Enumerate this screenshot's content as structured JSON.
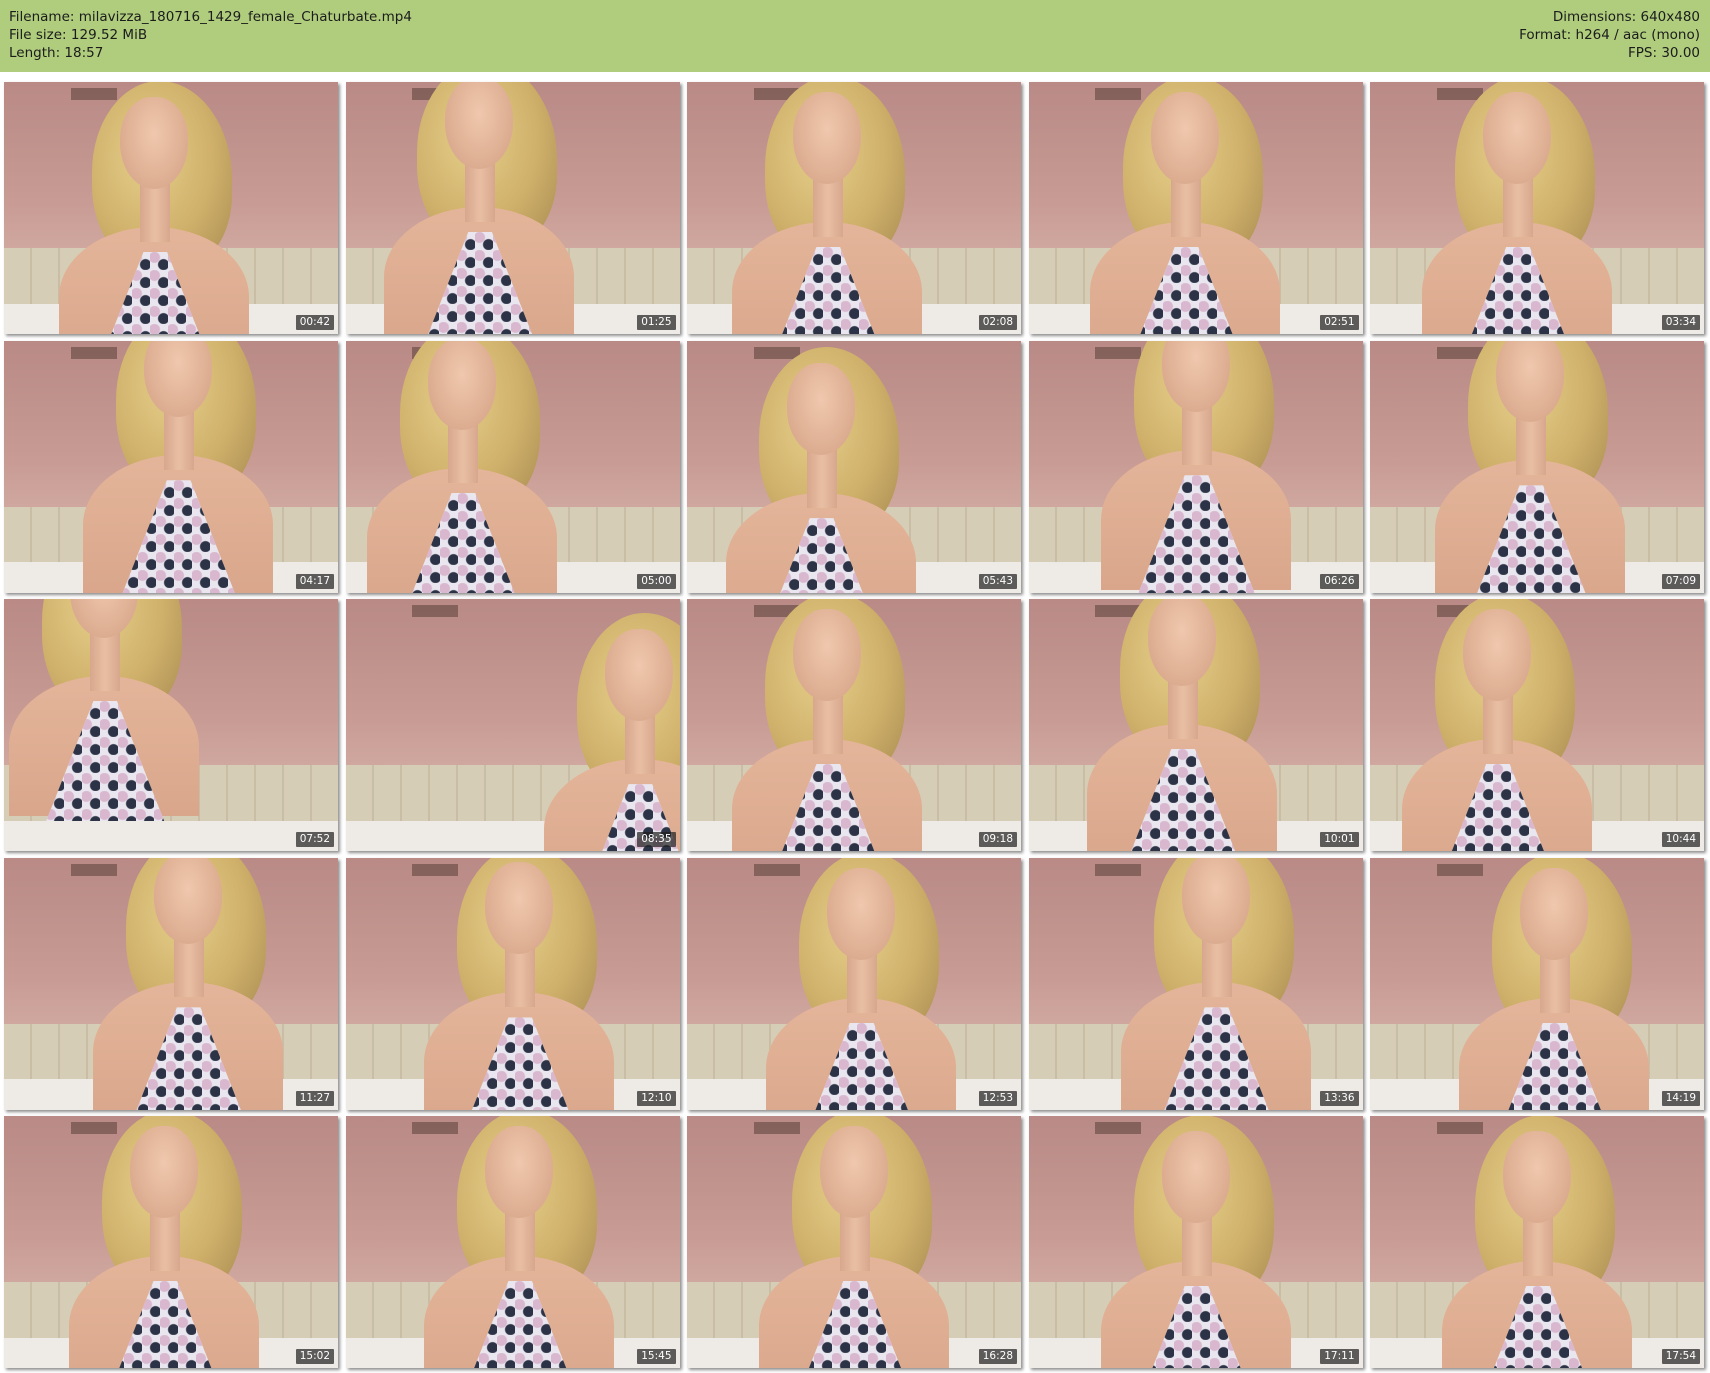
{
  "header": {
    "left": [
      "Filename: milavizza_180716_1429_female_Chaturbate.mp4",
      "File size: 129.52 MiB",
      "Length: 18:57"
    ],
    "right": [
      "Dimensions: 640x480",
      "Format: h264 / aac (mono)",
      "FPS: 30.00"
    ]
  },
  "colors": {
    "header_bg": "#afcd7d",
    "timestamp_bg": "#1e1e1e"
  },
  "thumbnails": [
    {
      "time": "00:42"
    },
    {
      "time": "01:25"
    },
    {
      "time": "02:08"
    },
    {
      "time": "02:51"
    },
    {
      "time": "03:34"
    },
    {
      "time": "04:17"
    },
    {
      "time": "05:00"
    },
    {
      "time": "05:43"
    },
    {
      "time": "06:26"
    },
    {
      "time": "07:09"
    },
    {
      "time": "07:52"
    },
    {
      "time": "08:35"
    },
    {
      "time": "09:18"
    },
    {
      "time": "10:01"
    },
    {
      "time": "10:44"
    },
    {
      "time": "11:27"
    },
    {
      "time": "12:10"
    },
    {
      "time": "12:53"
    },
    {
      "time": "13:36"
    },
    {
      "time": "14:19"
    },
    {
      "time": "15:02"
    },
    {
      "time": "15:45"
    },
    {
      "time": "16:28"
    },
    {
      "time": "17:11"
    },
    {
      "time": "17:54"
    }
  ]
}
